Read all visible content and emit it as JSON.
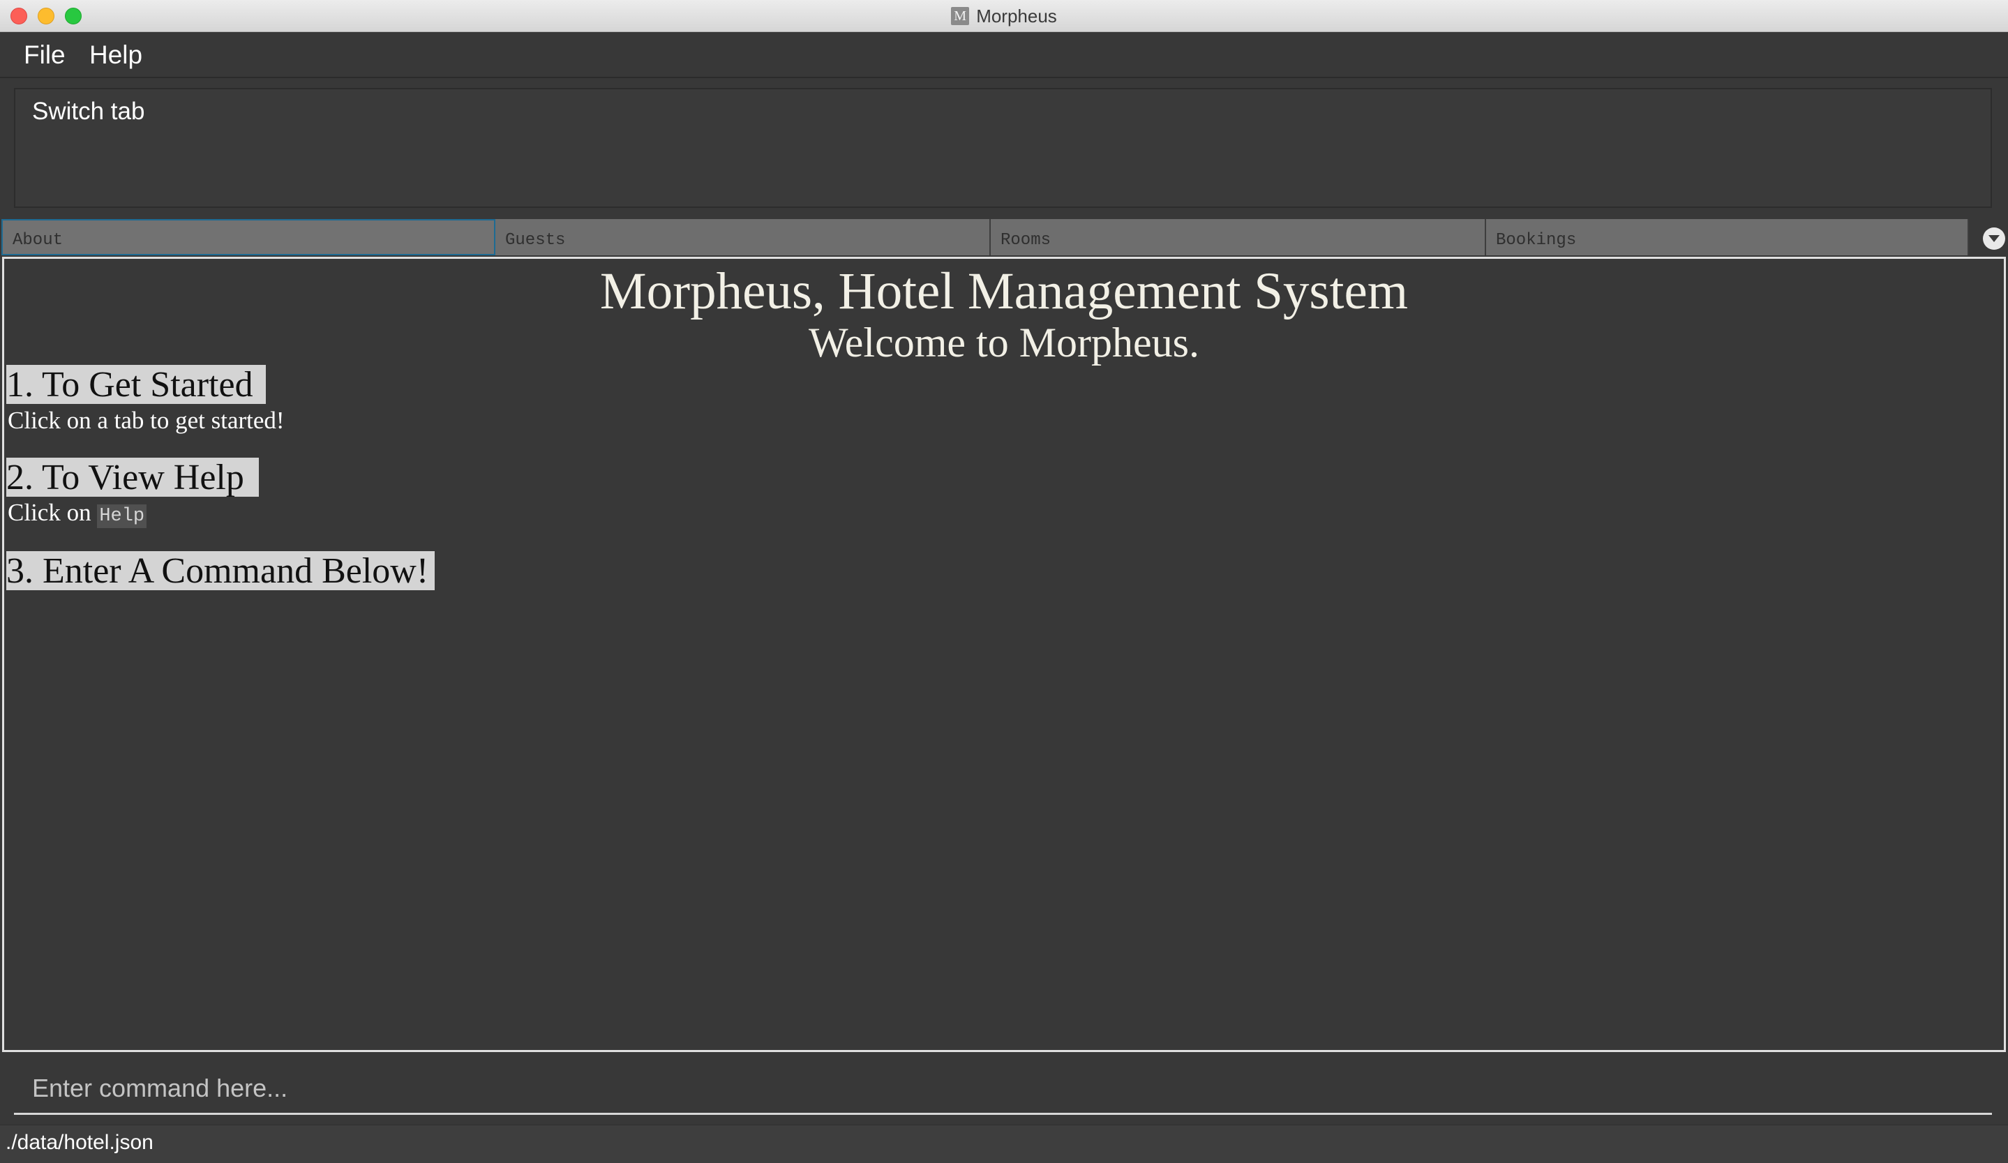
{
  "window": {
    "title": "Morpheus",
    "icon_letter": "M"
  },
  "menu": {
    "file": "File",
    "help": "Help"
  },
  "result_display": {
    "text": "Switch tab"
  },
  "tabs": [
    {
      "label": "About",
      "active": true
    },
    {
      "label": "Guests",
      "active": false
    },
    {
      "label": "Rooms",
      "active": false
    },
    {
      "label": "Bookings",
      "active": false
    }
  ],
  "tab_menu_icon": "chevron-down-icon",
  "about": {
    "title": "Morpheus, Hotel Management System",
    "subtitle": "Welcome to Morpheus.",
    "sections": [
      {
        "heading": "1. To Get Started",
        "text": "Click on a tab to get started!"
      },
      {
        "heading": "2. To View Help",
        "text_prefix": "Click on",
        "code": "Help"
      },
      {
        "heading": "3. Enter A Command Below!"
      }
    ]
  },
  "command": {
    "placeholder": "Enter command here...",
    "value": ""
  },
  "status": {
    "file_path": "./data/hotel.json"
  }
}
